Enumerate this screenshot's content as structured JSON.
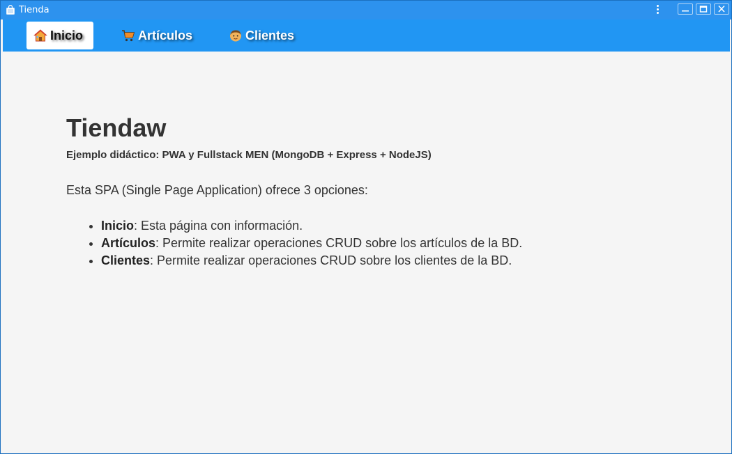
{
  "window": {
    "title": "Tienda"
  },
  "nav": {
    "items": [
      {
        "label": "Inicio",
        "icon": "home-icon",
        "active": true
      },
      {
        "label": "Artículos",
        "icon": "shopping-cart-icon",
        "active": false
      },
      {
        "label": "Clientes",
        "icon": "person-icon",
        "active": false
      }
    ]
  },
  "main": {
    "title": "Tiendaw",
    "subtitle": "Ejemplo didáctico: PWA y Fullstack MEN (MongoDB + Express + NodeJS)",
    "intro": "Esta SPA (Single Page Application) ofrece 3 opciones:",
    "options": [
      {
        "name": "Inicio",
        "description": ": Esta página con información."
      },
      {
        "name": "Artículos",
        "description": ": Permite realizar operaciones CRUD sobre los artículos de la BD."
      },
      {
        "name": "Clientes",
        "description": ": Permite realizar operaciones CRUD sobre los clientes de la BD."
      }
    ]
  },
  "colors": {
    "titlebar": "#2d92ee",
    "navbar": "#2196f3",
    "background": "#f5f5f5",
    "text": "#333333"
  }
}
